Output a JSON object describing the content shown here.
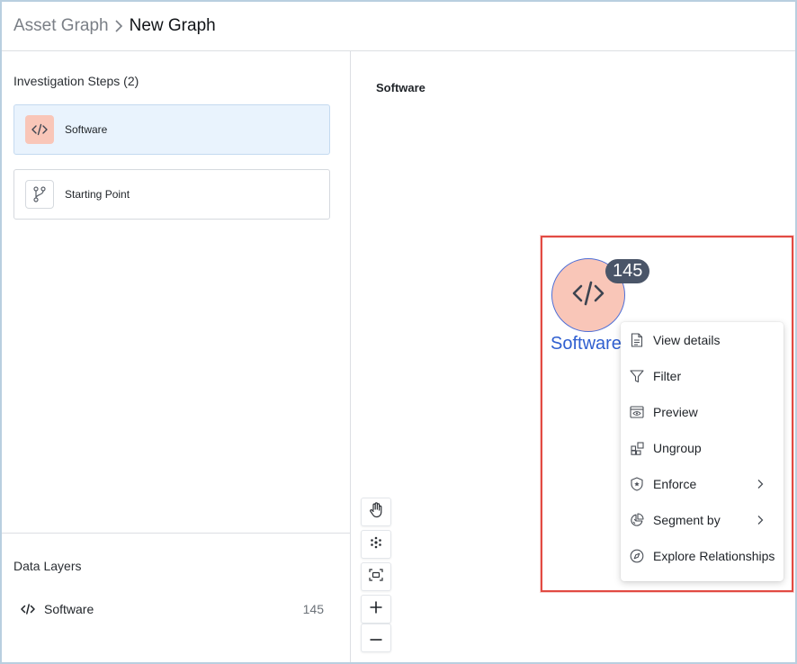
{
  "breadcrumb": {
    "root": "Asset Graph",
    "current": "New Graph"
  },
  "left_panel": {
    "steps_title": "Investigation Steps (2)",
    "steps": [
      {
        "label": "Software",
        "icon": "code-icon",
        "selected": true
      },
      {
        "label": "Starting Point",
        "icon": "branch-icon",
        "selected": false
      }
    ],
    "layers_title": "Data Layers",
    "layers": [
      {
        "label": "Software",
        "count": "145",
        "icon": "code-icon"
      }
    ]
  },
  "canvas": {
    "title": "Software",
    "node": {
      "label": "Software",
      "count": "145",
      "icon": "code-icon",
      "fill_color": "#f9c6b8",
      "label_color": "#2f5fd0"
    },
    "tools": [
      {
        "icon": "hand-icon"
      },
      {
        "icon": "snowflake-icon"
      },
      {
        "icon": "fit-screen-icon"
      },
      {
        "icon": "zoom-in-icon"
      },
      {
        "icon": "zoom-out-icon"
      }
    ]
  },
  "context_menu": {
    "items": [
      {
        "label": "View details",
        "icon": "document-icon"
      },
      {
        "label": "Filter",
        "icon": "filter-icon"
      },
      {
        "label": "Preview",
        "icon": "preview-icon"
      },
      {
        "label": "Ungroup",
        "icon": "ungroup-icon"
      },
      {
        "label": "Enforce",
        "icon": "shield-icon",
        "has_submenu": true
      },
      {
        "label": "Segment by",
        "icon": "segment-icon",
        "has_submenu": true
      },
      {
        "label": "Explore Relationships",
        "icon": "compass-icon"
      }
    ]
  },
  "colors": {
    "highlight_border": "#e24b43",
    "selected_step_bg": "#e9f3fd",
    "badge_bg": "#4a5568"
  }
}
